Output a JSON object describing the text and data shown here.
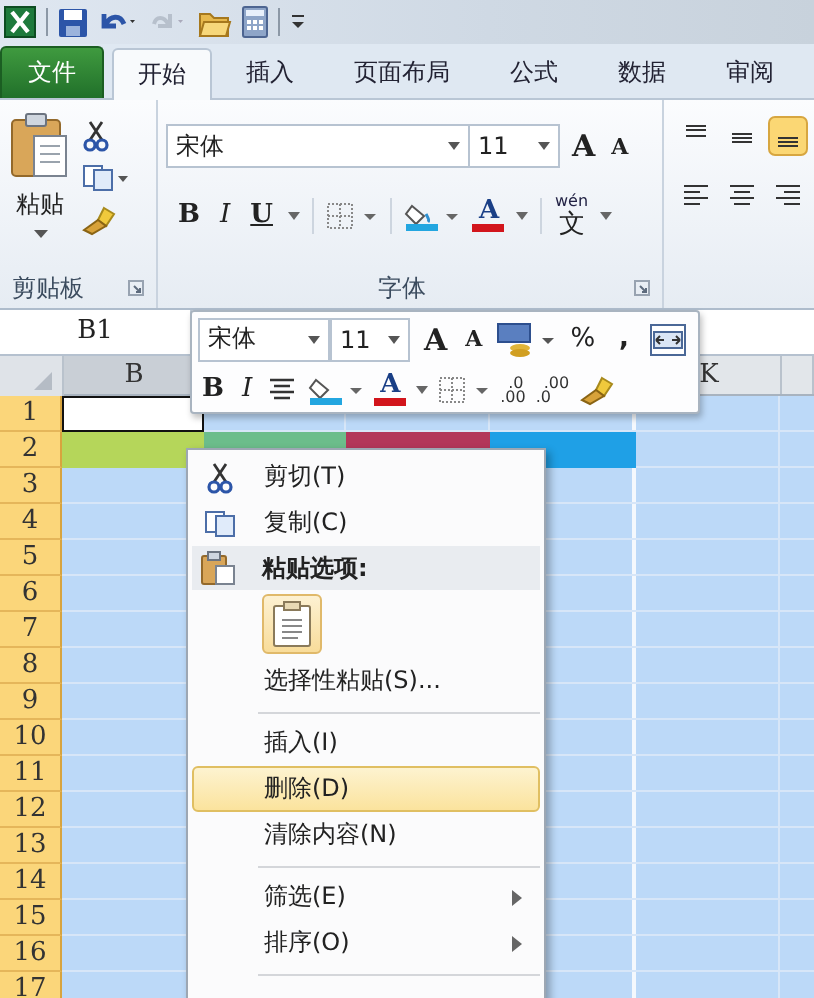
{
  "ribbon_tabs": [
    {
      "label": "文件",
      "kind": "file",
      "selected": false
    },
    {
      "label": "开始",
      "kind": "tab",
      "selected": true
    },
    {
      "label": "插入",
      "kind": "tab",
      "selected": false
    },
    {
      "label": "页面布局",
      "kind": "tab",
      "selected": false
    },
    {
      "label": "公式",
      "kind": "tab",
      "selected": false
    },
    {
      "label": "数据",
      "kind": "tab",
      "selected": false
    },
    {
      "label": "审阅",
      "kind": "tab",
      "selected": false
    }
  ],
  "clipboard_group": {
    "paste_label": "粘贴",
    "label": "剪贴板"
  },
  "font_group": {
    "font": "宋体",
    "size": "11",
    "grow": "A",
    "shrink": "A",
    "bold": "B",
    "italic": "I",
    "underline": "U",
    "font_color": "A",
    "pinyin": "wén",
    "phonetic": "文",
    "label": "字体"
  },
  "name_box": "B1",
  "mini_toolbar": {
    "font": "宋体",
    "size": "11",
    "grow": "A",
    "shrink": "A",
    "percent": "%",
    "comma": ",",
    "bold": "B",
    "italic": "I",
    "font_color": "A",
    "decimals": [
      {
        "top": ".0",
        "bottom": ".00"
      },
      {
        "top": ".00",
        "bottom": ".0"
      }
    ]
  },
  "columns": [
    {
      "label": "B",
      "color": "#b5d65a"
    },
    {
      "color": "#6cbd8b"
    },
    {
      "color": "#b3375a"
    },
    {
      "color": "#1fa0e6"
    },
    {
      "label": "K"
    }
  ],
  "rows": [
    "1",
    "2",
    "3",
    "4",
    "5",
    "6",
    "7",
    "8",
    "9",
    "10",
    "11",
    "12",
    "13",
    "14",
    "15",
    "16",
    "17"
  ],
  "context_menu": [
    {
      "kind": "cut",
      "label": "剪切(T)",
      "selected": false
    },
    {
      "kind": "copy",
      "label": "复制(C)",
      "selected": false
    },
    {
      "kind": "header",
      "label": "粘贴选项:"
    },
    {
      "kind": "paste"
    },
    {
      "kind": "command",
      "label": "选择性粘贴(S)...",
      "selected": false
    },
    {
      "kind": "separator"
    },
    {
      "kind": "command",
      "label": "插入(I)",
      "selected": false
    },
    {
      "kind": "command",
      "label": "删除(D)",
      "selected": true
    },
    {
      "kind": "command",
      "label": "清除内容(N)",
      "selected": false
    },
    {
      "kind": "separator"
    },
    {
      "kind": "submenu",
      "label": "筛选(E)",
      "selected": false
    },
    {
      "kind": "submenu",
      "label": "排序(O)",
      "selected": false
    },
    {
      "kind": "separator"
    }
  ]
}
